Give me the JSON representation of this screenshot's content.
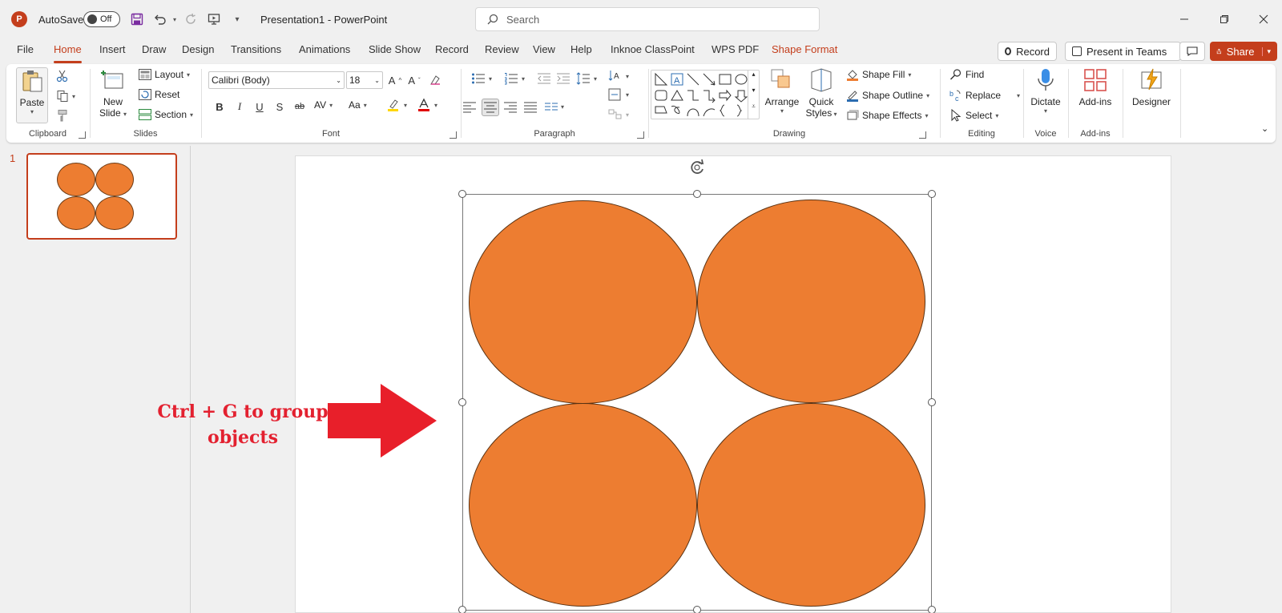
{
  "titlebar": {
    "app_logo": "P",
    "autosave_label": "AutoSave",
    "autosave_state": "Off",
    "doc_title": "Presentation1  -  PowerPoint",
    "search_placeholder": "Search"
  },
  "menu_tabs": [
    "File",
    "Home",
    "Insert",
    "Draw",
    "Design",
    "Transitions",
    "Animations",
    "Slide Show",
    "Record",
    "Review",
    "View",
    "Help",
    "Inknoe ClassPoint",
    "WPS PDF",
    "Shape Format"
  ],
  "active_tab": "Home",
  "contextual_tab": "Shape Format",
  "header_buttons": {
    "record": "Record",
    "present_teams": "Present in Teams",
    "share": "Share"
  },
  "ribbon": {
    "clipboard": {
      "label": "Clipboard",
      "paste": "Paste"
    },
    "slides": {
      "label": "Slides",
      "new_slide": "New Slide",
      "new_slide_l1": "New",
      "new_slide_l2": "Slide",
      "layout": "Layout",
      "reset": "Reset",
      "section": "Section"
    },
    "font": {
      "label": "Font",
      "font_name": "Calibri (Body)",
      "font_size": "18",
      "bold": "B",
      "italic": "I",
      "underline": "U",
      "shadow": "S",
      "strike": "ab",
      "spacing": "AV",
      "case": "Aa"
    },
    "paragraph": {
      "label": "Paragraph"
    },
    "drawing": {
      "label": "Drawing",
      "arrange": "Arrange",
      "quick_styles_l1": "Quick",
      "quick_styles_l2": "Styles",
      "shape_fill": "Shape Fill",
      "shape_outline": "Shape Outline",
      "shape_effects": "Shape Effects"
    },
    "editing": {
      "label": "Editing",
      "find": "Find",
      "replace": "Replace",
      "select": "Select"
    },
    "voice": {
      "label": "Voice",
      "dictate": "Dictate"
    },
    "addins": {
      "label": "Add-ins",
      "addins": "Add-ins"
    },
    "designer": {
      "designer": "Designer"
    }
  },
  "thumbnail": {
    "slide_number": "1"
  },
  "slide": {
    "annotation_line1": "Ctrl + G to group",
    "annotation_line2": "objects",
    "shape_fill_color": "#ED7D31",
    "arrow_color": "#E81F2A"
  },
  "colors": {
    "accent": "#C43E1C",
    "shape_orange": "#ED7D31",
    "annotation_red": "#E32130"
  }
}
